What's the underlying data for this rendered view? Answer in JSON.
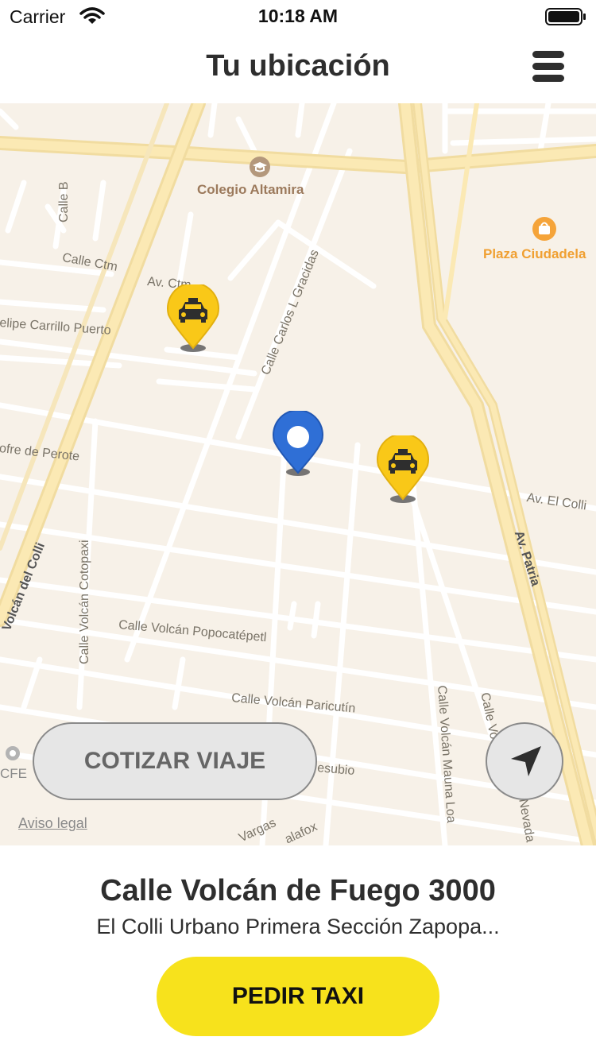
{
  "status_bar": {
    "carrier": "Carrier",
    "time": "10:18 AM"
  },
  "nav": {
    "title": "Tu ubicación",
    "menu_icon": "hamburger-menu-icon"
  },
  "map": {
    "pois": [
      {
        "label": "Colegio Altamira",
        "icon": "school-icon"
      },
      {
        "label": "Plaza Ciudadela",
        "icon": "shopping-bag-icon"
      },
      {
        "label": "CFE",
        "icon": "poi-dot-icon"
      }
    ],
    "streets": [
      "Calle B",
      "Calle Ctm",
      "Av. Ctm",
      "elipe Carrillo Puerto",
      "Calle Carlos L Gracidas",
      "ofre de Perote",
      "Av. El Colli",
      "Av. Patria",
      "Volcán del Colli",
      "Calle Volcán Cotopaxi",
      "Calle Volcán Popocatépetl",
      "Calle Volcán Paricutín",
      "Calle Volcán Mauna Loa",
      "Calle Vo",
      "Nevada",
      "esubio",
      "Vargas",
      "alafox"
    ],
    "legal_link": "Aviso legal",
    "markers": {
      "user": "user-location-pin",
      "taxis": [
        "taxi-pin",
        "taxi-pin"
      ]
    }
  },
  "actions": {
    "cotizar": "COTIZAR VIAJE",
    "pedir": "PEDIR TAXI",
    "locate_icon": "navigation-arrow-icon"
  },
  "address": {
    "main": "Calle Volcán de Fuego 3000",
    "sub": "El Colli Urbano Primera Sección Zapopa..."
  },
  "colors": {
    "accent_yellow": "#f7e21c",
    "user_pin_blue": "#2f6fd6",
    "map_background": "#f7f1e8",
    "major_road": "#fbe7a8"
  }
}
